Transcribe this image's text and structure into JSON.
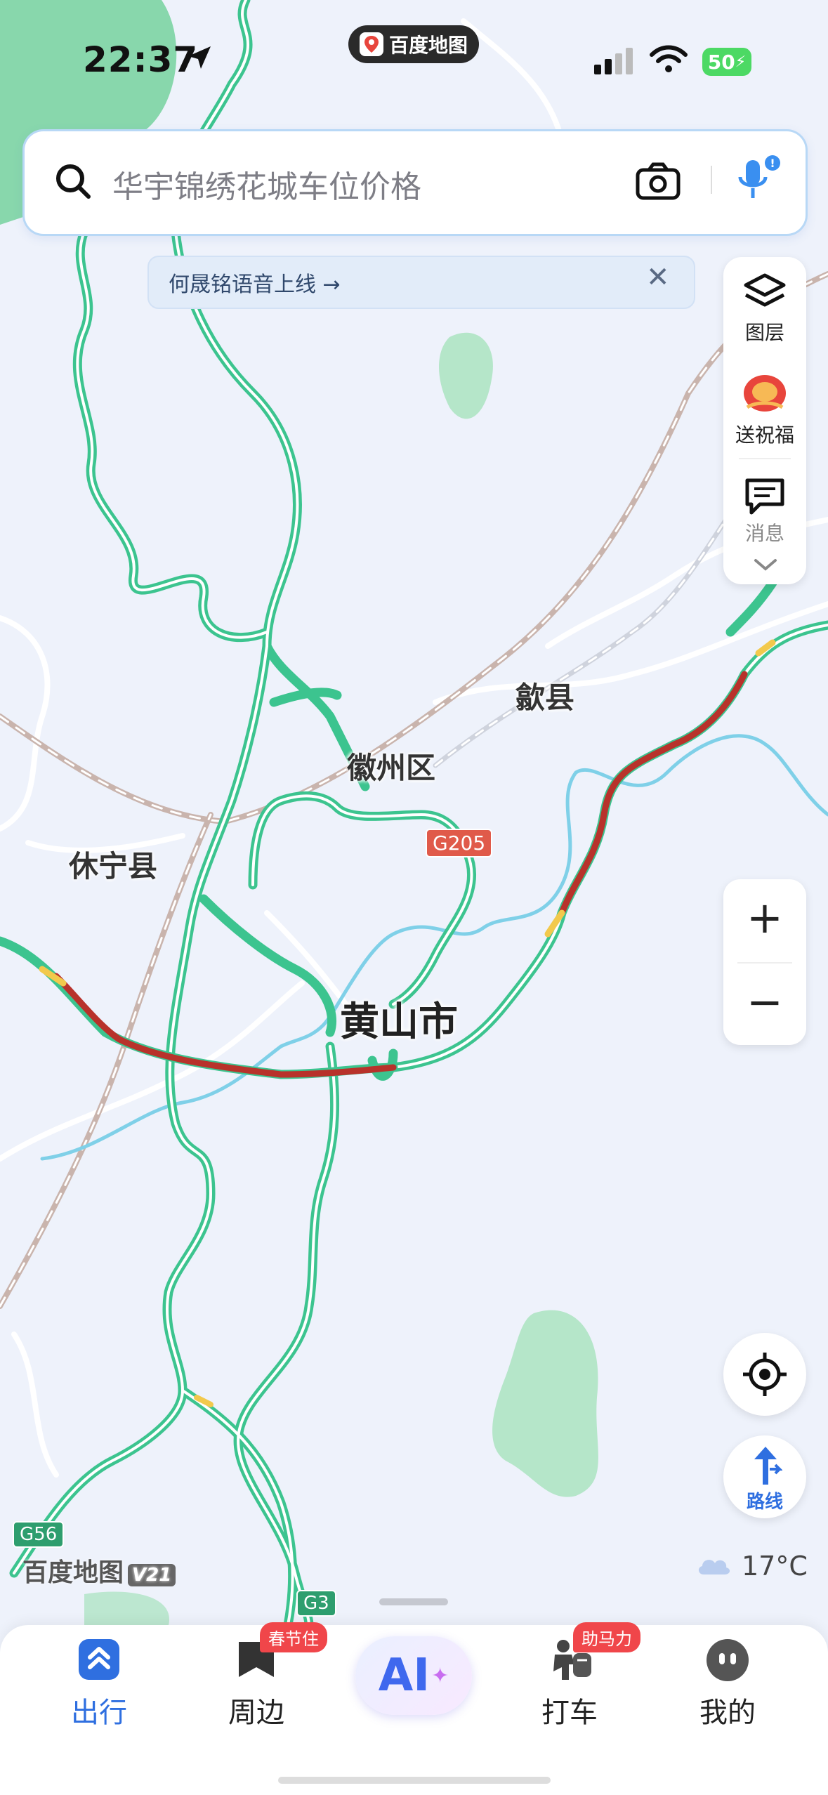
{
  "status": {
    "time": "22:37",
    "battery": "50"
  },
  "app_pill": {
    "title": "百度地图"
  },
  "search": {
    "placeholder": "华宇锦绣花城车位价格"
  },
  "toast": {
    "text": "何晟铭语音上线 →",
    "close": "✕"
  },
  "side_panel": {
    "layers": "图层",
    "blessing": "送祝福",
    "messages": "消息"
  },
  "zoom": {
    "plus": "+",
    "minus": "−"
  },
  "route_button": {
    "label": "路线"
  },
  "map": {
    "places": {
      "shexian": "歙县",
      "huizhou": "徽州区",
      "xiuning": "休宁县",
      "huangshan": "黄山市"
    },
    "shields": {
      "g205": "G205",
      "g56": "G56",
      "g3": "G3"
    },
    "brand": "百度地图",
    "brand_version": "V21",
    "weather": "17°C"
  },
  "nav": {
    "items": [
      {
        "label": "出行",
        "active": true
      },
      {
        "label": "周边",
        "badge": "春节住"
      },
      {
        "label": "AI"
      },
      {
        "label": "打车",
        "badge": "助马力"
      },
      {
        "label": "我的"
      }
    ]
  },
  "colors": {
    "accent": "#2f6fe0",
    "road_green": "#3cc48f",
    "road_red": "#c0392b",
    "map_bg": "#eef2fb"
  }
}
